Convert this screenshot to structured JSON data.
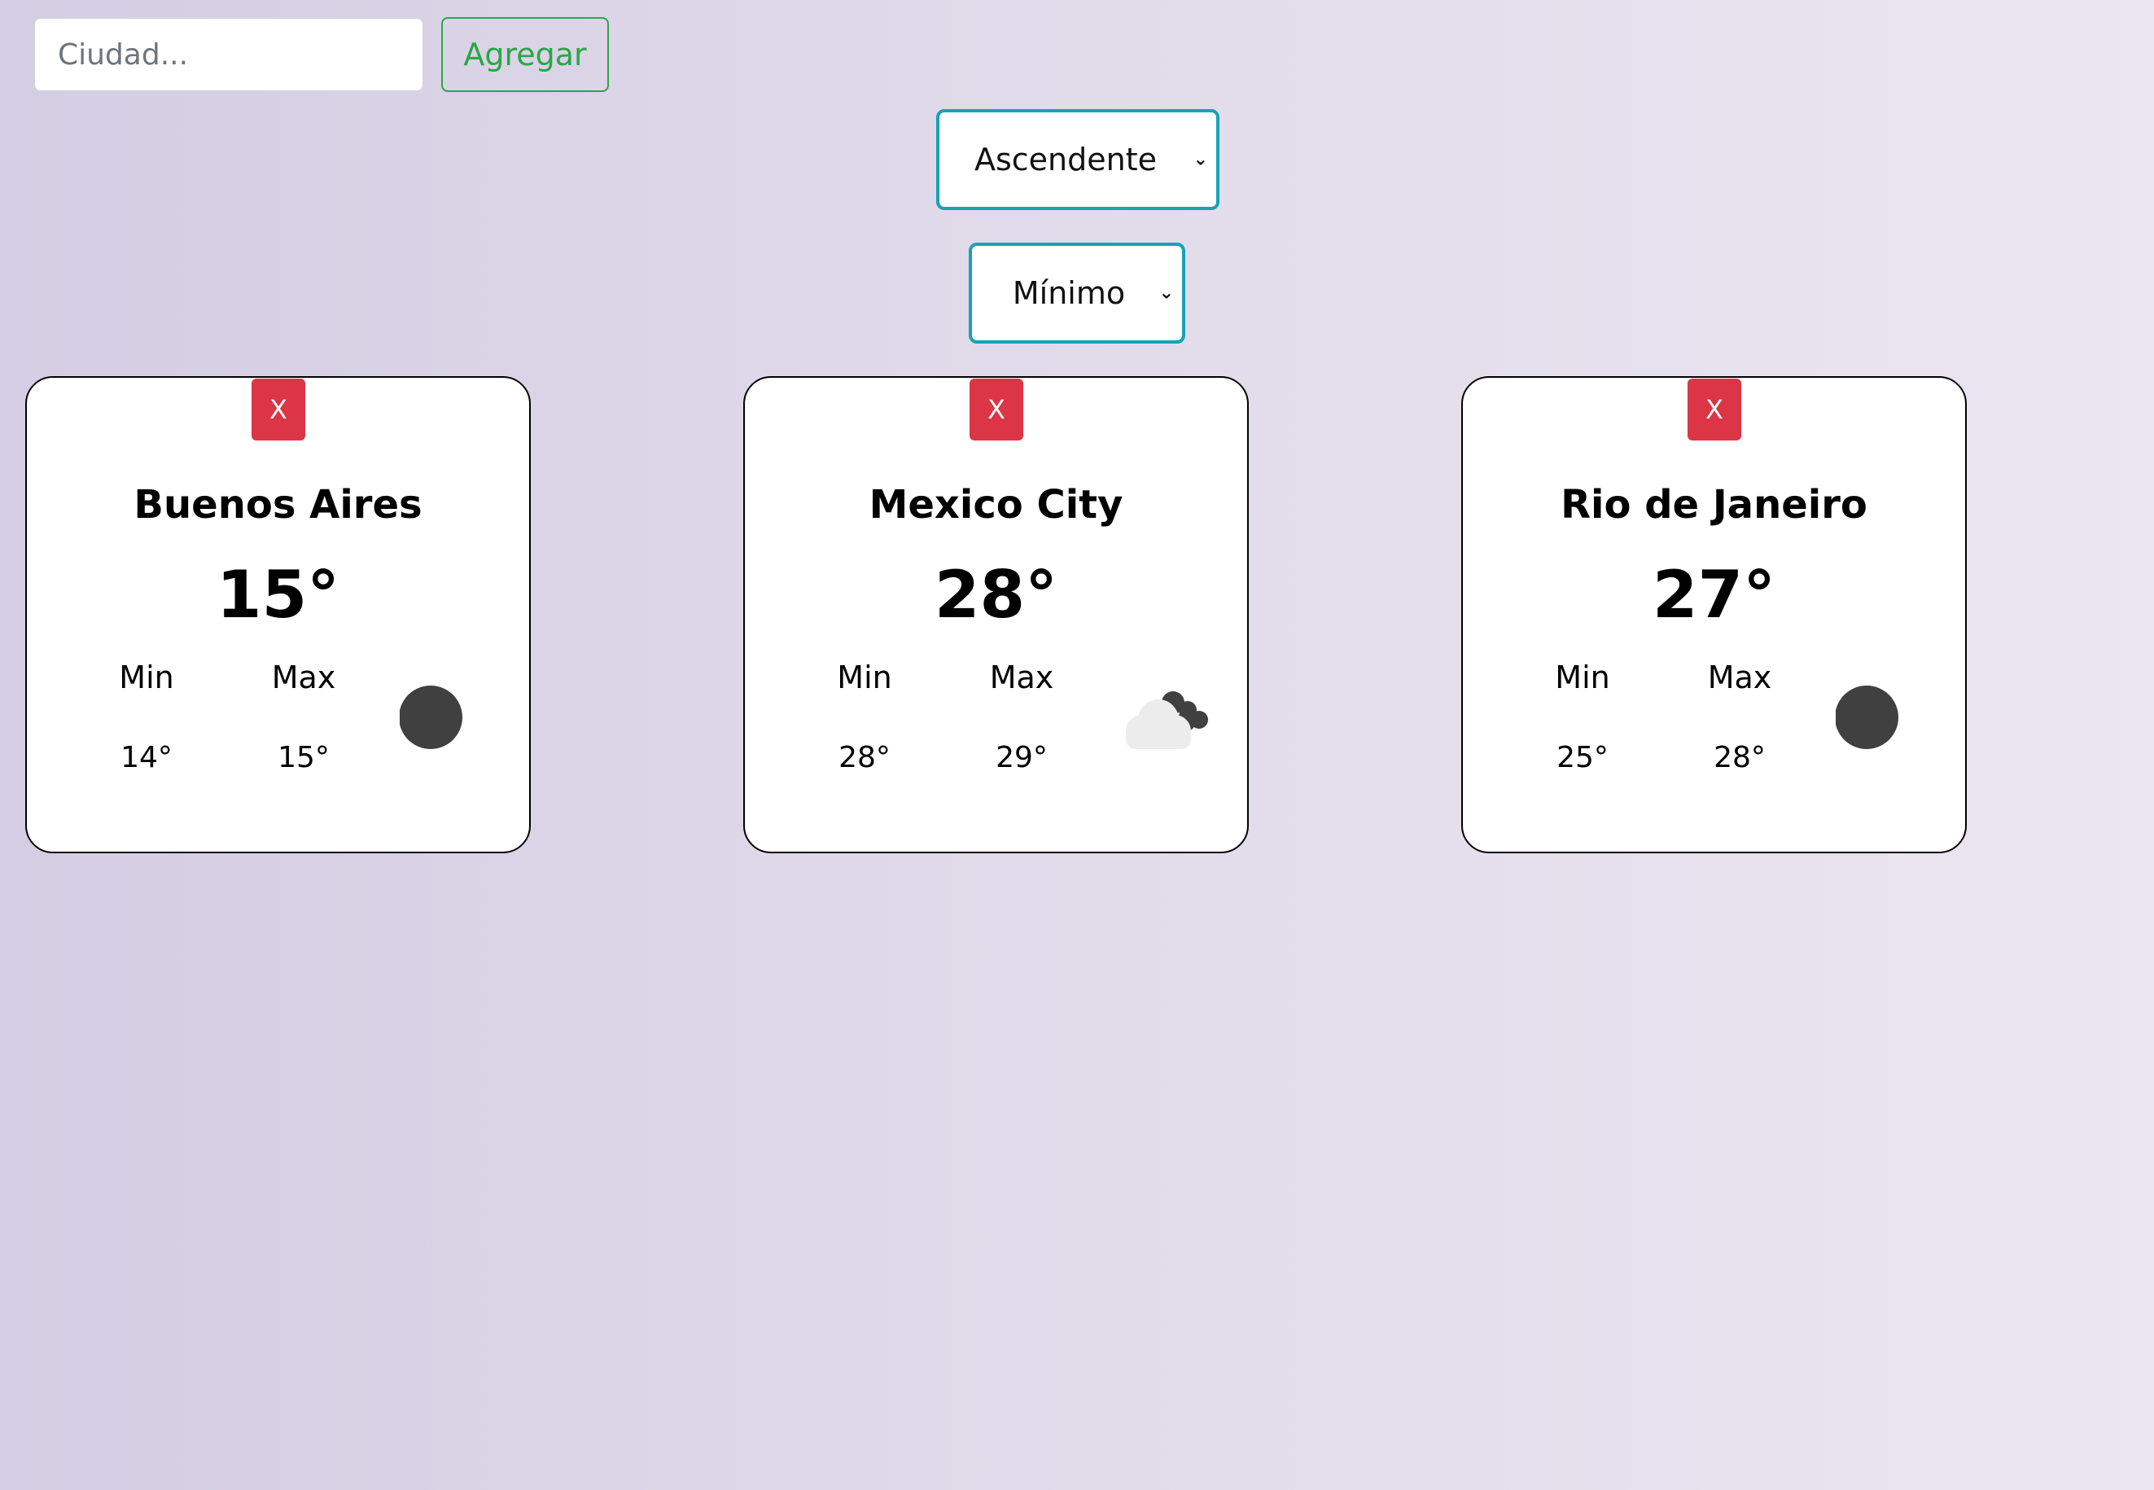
{
  "search": {
    "placeholder": "Ciudad..."
  },
  "add_button": {
    "label": "Agregar"
  },
  "order_select": {
    "selected": "Ascendente"
  },
  "sort_select": {
    "selected": "Mínimo"
  },
  "labels": {
    "min": "Min",
    "max": "Max",
    "close": "X"
  },
  "colors": {
    "close_button": "#dc3545",
    "add_button": "#28a745",
    "select_border": "#17a2b8",
    "icon_dark": "#404040",
    "cloud_light": "#ececec"
  },
  "cities": [
    {
      "name": "Buenos Aires",
      "temp": "15°",
      "min": "14°",
      "max": "15°",
      "icon": "dark-circle-icon"
    },
    {
      "name": "Mexico City",
      "temp": "28°",
      "min": "28°",
      "max": "29°",
      "icon": "cloud-icon"
    },
    {
      "name": "Rio de Janeiro",
      "temp": "27°",
      "min": "25°",
      "max": "28°",
      "icon": "dark-circle-icon"
    }
  ]
}
